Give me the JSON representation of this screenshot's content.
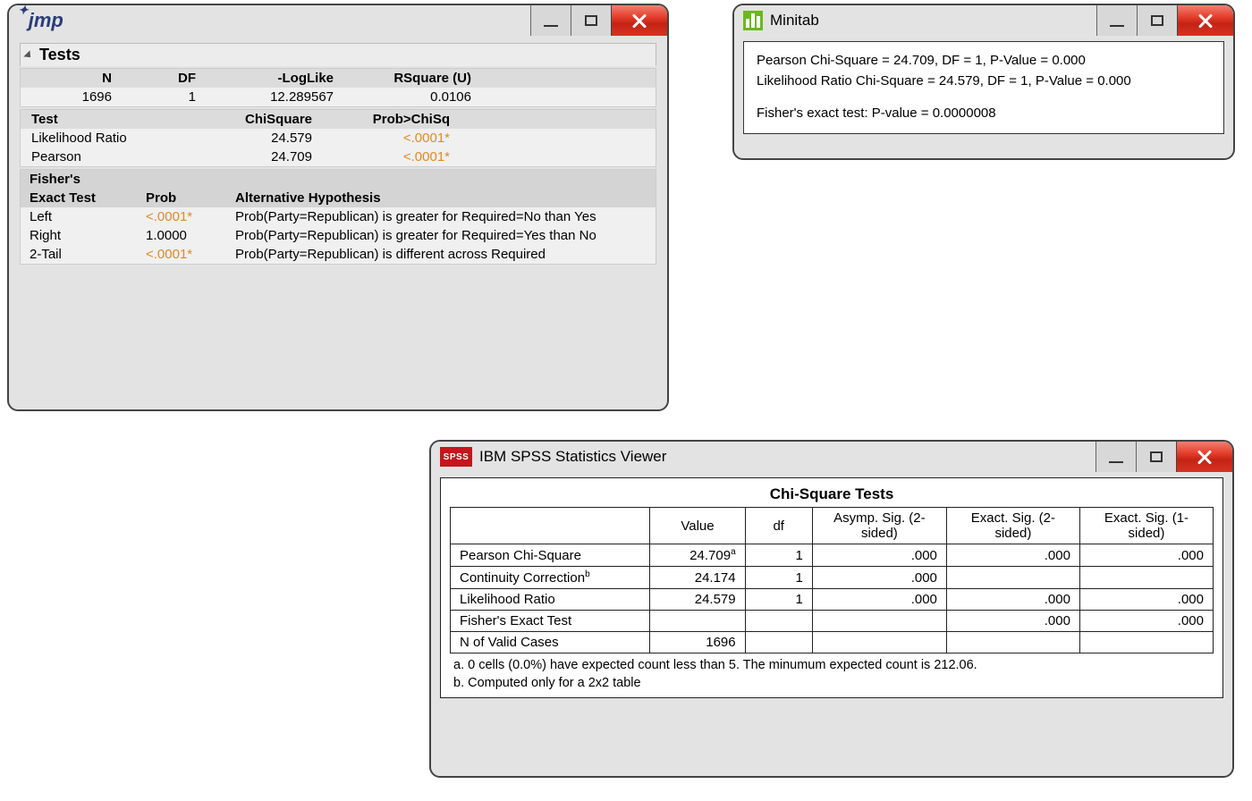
{
  "jmp": {
    "logo_text": "jmp",
    "section_title": "Tests",
    "summary_headers": [
      "N",
      "DF",
      "-LogLike",
      "RSquare (U)"
    ],
    "summary_values": [
      "1696",
      "1",
      "12.289567",
      "0.0106"
    ],
    "test_headers": [
      "Test",
      "ChiSquare",
      "Prob>ChiSq"
    ],
    "tests": [
      {
        "name": "Likelihood Ratio",
        "chisq": "24.579",
        "prob": "<.0001*",
        "sig": true
      },
      {
        "name": "Pearson",
        "chisq": "24.709",
        "prob": "<.0001*",
        "sig": true
      }
    ],
    "fisher_header1": "Fisher's",
    "fisher_header2": "Exact Test",
    "fisher_cols": [
      "Prob",
      "Alternative Hypothesis"
    ],
    "fisher_rows": [
      {
        "side": "Left",
        "prob": "<.0001*",
        "sig": true,
        "alt": "Prob(Party=Republican) is greater for Required=No than Yes"
      },
      {
        "side": "Right",
        "prob": "1.0000",
        "sig": false,
        "alt": "Prob(Party=Republican) is greater for Required=Yes than No"
      },
      {
        "side": "2-Tail",
        "prob": "<.0001*",
        "sig": true,
        "alt": "Prob(Party=Republican) is different across Required"
      }
    ]
  },
  "minitab": {
    "app_title": "Minitab",
    "line1": "Pearson Chi-Square = 24.709, DF = 1, P-Value = 0.000",
    "line2": "Likelihood Ratio Chi-Square = 24.579, DF = 1, P-Value = 0.000",
    "line3": "Fisher's exact test: P-value = 0.0000008"
  },
  "spss": {
    "icon_text": "SPSS",
    "app_title": "IBM SPSS Statistics Viewer",
    "grid_title": "Chi-Square Tests",
    "col_headers": [
      "",
      "Value",
      "df",
      "Asymp. Sig. (2-sided)",
      "Exact. Sig. (2-sided)",
      "Exact. Sig. (1-sided)"
    ],
    "rows": [
      {
        "label": "Pearson Chi-Square",
        "value": "24.709",
        "sup": "a",
        "df": "1",
        "asymp": ".000",
        "ex2": ".000",
        "ex1": ".000"
      },
      {
        "label": "Continuity Correction",
        "labsup": "b",
        "value": "24.174",
        "df": "1",
        "asymp": ".000",
        "ex2": "",
        "ex1": ""
      },
      {
        "label": "Likelihood Ratio",
        "value": "24.579",
        "df": "1",
        "asymp": ".000",
        "ex2": ".000",
        "ex1": ".000"
      },
      {
        "label": "Fisher's Exact Test",
        "value": "",
        "df": "",
        "asymp": "",
        "ex2": ".000",
        "ex1": ".000"
      },
      {
        "label": "N of Valid Cases",
        "value": "1696",
        "df": "",
        "asymp": "",
        "ex2": "",
        "ex1": ""
      }
    ],
    "footnote_a": "a. 0 cells (0.0%) have expected count less than 5. The minumum expected count is 212.06.",
    "footnote_b": "b. Computed only for a 2x2 table"
  }
}
